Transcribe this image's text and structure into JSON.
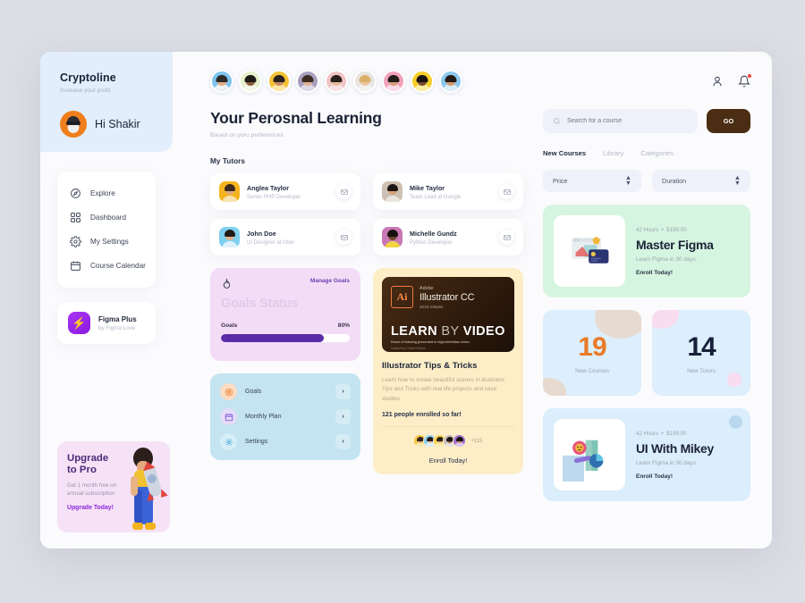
{
  "brand": {
    "name": "Cryptoline",
    "tagline": "Increase your profit",
    "greeting": "Hi Shakir"
  },
  "sidebar": {
    "nav": [
      {
        "label": "Explore",
        "icon": "compass-icon"
      },
      {
        "label": "Dashboard",
        "icon": "grid-icon"
      },
      {
        "label": "My Settings",
        "icon": "gear-icon"
      },
      {
        "label": "Course Calendar",
        "icon": "calendar-icon"
      }
    ],
    "promo": {
      "title": "Figma Plus",
      "subtitle": "by Figma Love",
      "icon": "bolt-icon"
    },
    "upgrade": {
      "title_line1": "Upgrade",
      "title_line2": "to Pro",
      "subtitle": "Get 1 month free on annual subscription",
      "cta": "Upgrade Today!"
    }
  },
  "topbar": {
    "avatars": [
      {
        "bg": "#7fc4ef",
        "hair": "#2d2a27",
        "skin": "#e3ab84"
      },
      {
        "bg": "#e6f0cd",
        "hair": "#1f1a16",
        "skin": "#8a5a3b"
      },
      {
        "bg": "#f4c235",
        "hair": "#2b211c",
        "skin": "#c98a5f"
      },
      {
        "bg": "#a9a0bd",
        "hair": "#3c2c24",
        "skin": "#e0b290"
      },
      {
        "bg": "#f0c5c5",
        "hair": "#2a201b",
        "skin": "#e6bb97"
      },
      {
        "bg": "#e7e4e1",
        "hair": "#d9b06a",
        "skin": "#eec4a3"
      },
      {
        "bg": "#f2a2bc",
        "hair": "#241c18",
        "skin": "#d69e79"
      },
      {
        "bg": "#f7cf2a",
        "hair": "#181310",
        "skin": "#7a4a2e"
      },
      {
        "bg": "#8cc9ef",
        "hair": "#241b16",
        "skin": "#cf9a72"
      }
    ],
    "profile_icon": "person-icon",
    "bell_icon": "bell-icon",
    "has_notification": true
  },
  "main": {
    "title": "Your Perosnal Learning",
    "subtitle": "Based on yoru preferences",
    "tutors_heading": "My Tutors",
    "tutors": [
      {
        "name": "Anglea Taylor",
        "role": "Senior PHP Developer",
        "bg": "#f5b41d",
        "hair": "#3a2a20",
        "skin": "#dfa980"
      },
      {
        "name": "Mike Taylor",
        "role": "Team Lead at Google",
        "bg": "#cdbfb2",
        "hair": "#1d1713",
        "skin": "#d6a079"
      },
      {
        "name": "John Doe",
        "role": "UI Designer at Uber",
        "bg": "#7fd0f0",
        "hair": "#221a16",
        "skin": "#e2b28c"
      },
      {
        "name": "Michelle Gundz",
        "role": "Python Developer",
        "bg": "#c878b4",
        "hair": "#16110e",
        "skin": "#6b4228"
      }
    ]
  },
  "goals": {
    "manage_label": "Manage Goals",
    "heading": "Goals Status",
    "row_label": "Goals",
    "percent": "80%",
    "percent_value": 80,
    "flame_icon": "flame-icon"
  },
  "quick_menu": [
    {
      "label": "Goals",
      "icon": "target-icon",
      "badge_bg": "#fbdcc2",
      "icon_color": "#f07d2b",
      "arrow": "›"
    },
    {
      "label": "Monthly Plan",
      "icon": "calendar-icon",
      "badge_bg": "#e4dcf8",
      "icon_color": "#7a52d6",
      "arrow": "›"
    },
    {
      "label": "Settings",
      "icon": "gear-icon",
      "badge_bg": "#d6eef7",
      "icon_color": "#2f9ad1",
      "arrow": "›"
    }
  ],
  "illustrator_course": {
    "thumb": {
      "badge": "Ai",
      "brand": "Adobe",
      "product": "Illustrator CC",
      "release": "2015 release",
      "headline_a": "LEARN ",
      "headline_b": "BY ",
      "headline_c": "VIDEO",
      "subline": "Hours of training presented in high-definition video",
      "host": "Hosted by Chad Chelius"
    },
    "title": "Illustrator Tips & Tricks",
    "description": "Learn how to create beautiful scenes in illustrator. Tips and Tricks with real life projects and case studies.",
    "enrolled": "121 people enrolled so far!",
    "more_count": "+115",
    "cta": "Enroll Today!",
    "enrolled_avatars": [
      {
        "bg": "#f5c542",
        "hair": "#33241c",
        "skin": "#d9a27a"
      },
      {
        "bg": "#8cd0ef",
        "hair": "#241b16",
        "skin": "#e6bb97"
      },
      {
        "bg": "#f7d24a",
        "hair": "#2b1f18",
        "skin": "#dfa87e"
      },
      {
        "bg": "#c9c0bb",
        "hair": "#1a1411",
        "skin": "#8a5c3c"
      },
      {
        "bg": "#a46fd0",
        "hair": "#17110e",
        "skin": "#c98d63"
      }
    ]
  },
  "search": {
    "placeholder": "Search for a course",
    "value": "",
    "go_label": "GO",
    "icon": "search-icon"
  },
  "right_tabs": [
    {
      "label": "New Courses",
      "active": true
    },
    {
      "label": "Library",
      "active": false
    },
    {
      "label": "Categories",
      "active": false
    }
  ],
  "filters": [
    {
      "label": "Price",
      "icon": "sort-icon"
    },
    {
      "label": "Duration",
      "icon": "sort-icon"
    }
  ],
  "course_cards": [
    {
      "meta_hours": "42 Hours",
      "meta_price": "$199.00",
      "title": "Master Figma",
      "description": "Learn Figma in 30 days.",
      "cta": "Enroll Today!",
      "accent": "#d6f5e0"
    },
    {
      "meta_hours": "42 Hours",
      "meta_price": "$199.00",
      "title": "UI With Mikey",
      "description": "Learn Figma in 30 days.",
      "cta": "Enroll Today!",
      "accent": "#dbeefb"
    }
  ],
  "stats": [
    {
      "value": "19",
      "label": "New Courses",
      "color": "#e97a27"
    },
    {
      "value": "14",
      "label": "New Tutors",
      "color": "#18203a"
    }
  ]
}
